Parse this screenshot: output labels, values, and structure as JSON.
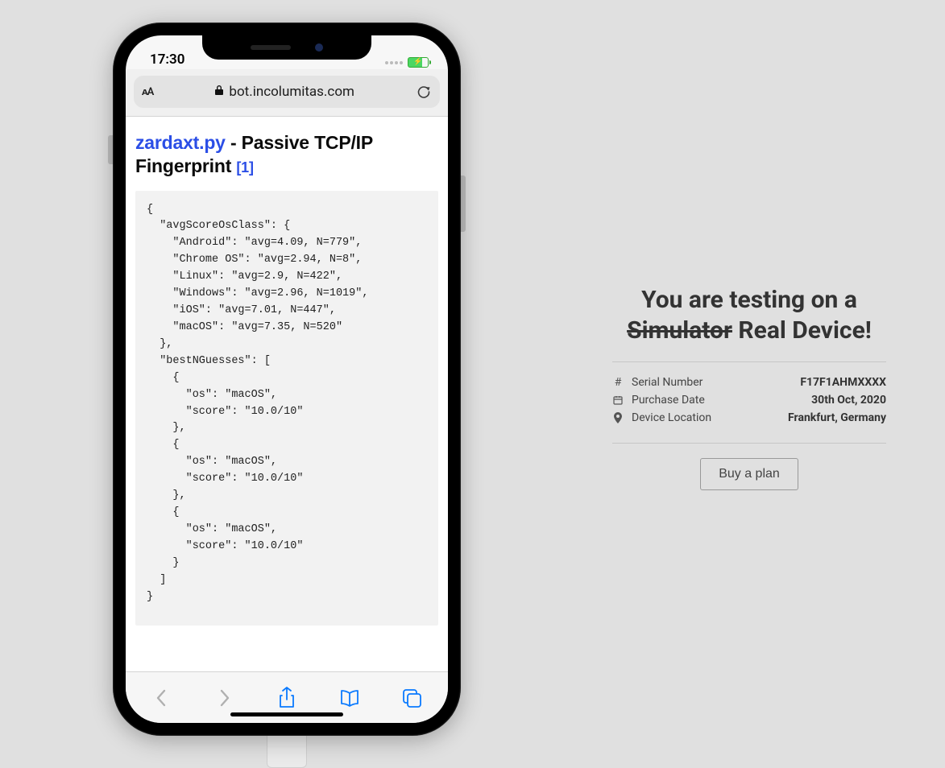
{
  "status": {
    "time": "17:30",
    "battery_icon": "charging"
  },
  "safari": {
    "text_size_label": "ᴀA",
    "domain": "bot.incolumitas.com"
  },
  "page": {
    "title_link": "zardaxt.py",
    "title_rest": " - Passive TCP/IP Fingerprint ",
    "title_ref": "[1]",
    "code": "{\n  \"avgScoreOsClass\": {\n    \"Android\": \"avg=4.09, N=779\",\n    \"Chrome OS\": \"avg=2.94, N=8\",\n    \"Linux\": \"avg=2.9, N=422\",\n    \"Windows\": \"avg=2.96, N=1019\",\n    \"iOS\": \"avg=7.01, N=447\",\n    \"macOS\": \"avg=7.35, N=520\"\n  },\n  \"bestNGuesses\": [\n    {\n      \"os\": \"macOS\",\n      \"score\": \"10.0/10\"\n    },\n    {\n      \"os\": \"macOS\",\n      \"score\": \"10.0/10\"\n    },\n    {\n      \"os\": \"macOS\",\n      \"score\": \"10.0/10\"\n    }\n  ]\n}"
  },
  "right": {
    "heading_pre": "You are testing on a ",
    "heading_strike": "Simulator",
    "heading_post": " Real Device!",
    "rows": {
      "serial_label": "Serial Number",
      "serial_value": "F17F1AHMXXXX",
      "date_label": "Purchase Date",
      "date_value": "30th Oct, 2020",
      "loc_label": "Device Location",
      "loc_value": "Frankfurt, Germany"
    },
    "cta": "Buy a plan"
  }
}
